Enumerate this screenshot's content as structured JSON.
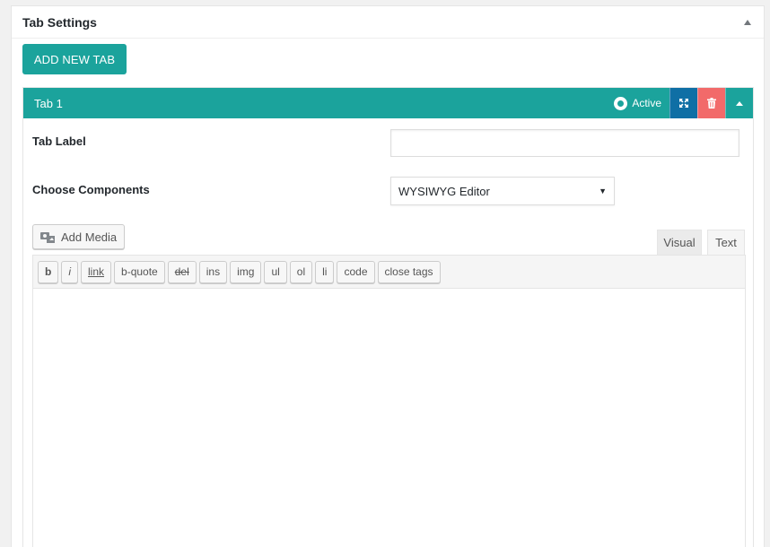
{
  "postbox": {
    "title": "Tab Settings"
  },
  "add_tab_button": "ADD NEW TAB",
  "tab": {
    "title": "Tab 1",
    "active_label": "Active",
    "fields": {
      "label_title": "Tab Label",
      "label_value": "",
      "components_title": "Choose Components",
      "components_selected": "WYSIWYG Editor"
    }
  },
  "editor": {
    "add_media": "Add Media",
    "tabs": {
      "visual": "Visual",
      "text": "Text"
    },
    "quicktags": [
      "b",
      "i",
      "link",
      "b-quote",
      "del",
      "ins",
      "img",
      "ul",
      "ol",
      "li",
      "code",
      "close tags"
    ],
    "content": ""
  },
  "colors": {
    "accent": "#1ba39c",
    "expand": "#0f6fa5",
    "delete": "#f26a6a"
  },
  "icons": {
    "collapse": "triangle-up-icon",
    "expand": "expand-arrows-icon",
    "delete": "trash-icon",
    "toggle": "chevron-up-icon",
    "media": "media-camera-icon"
  }
}
